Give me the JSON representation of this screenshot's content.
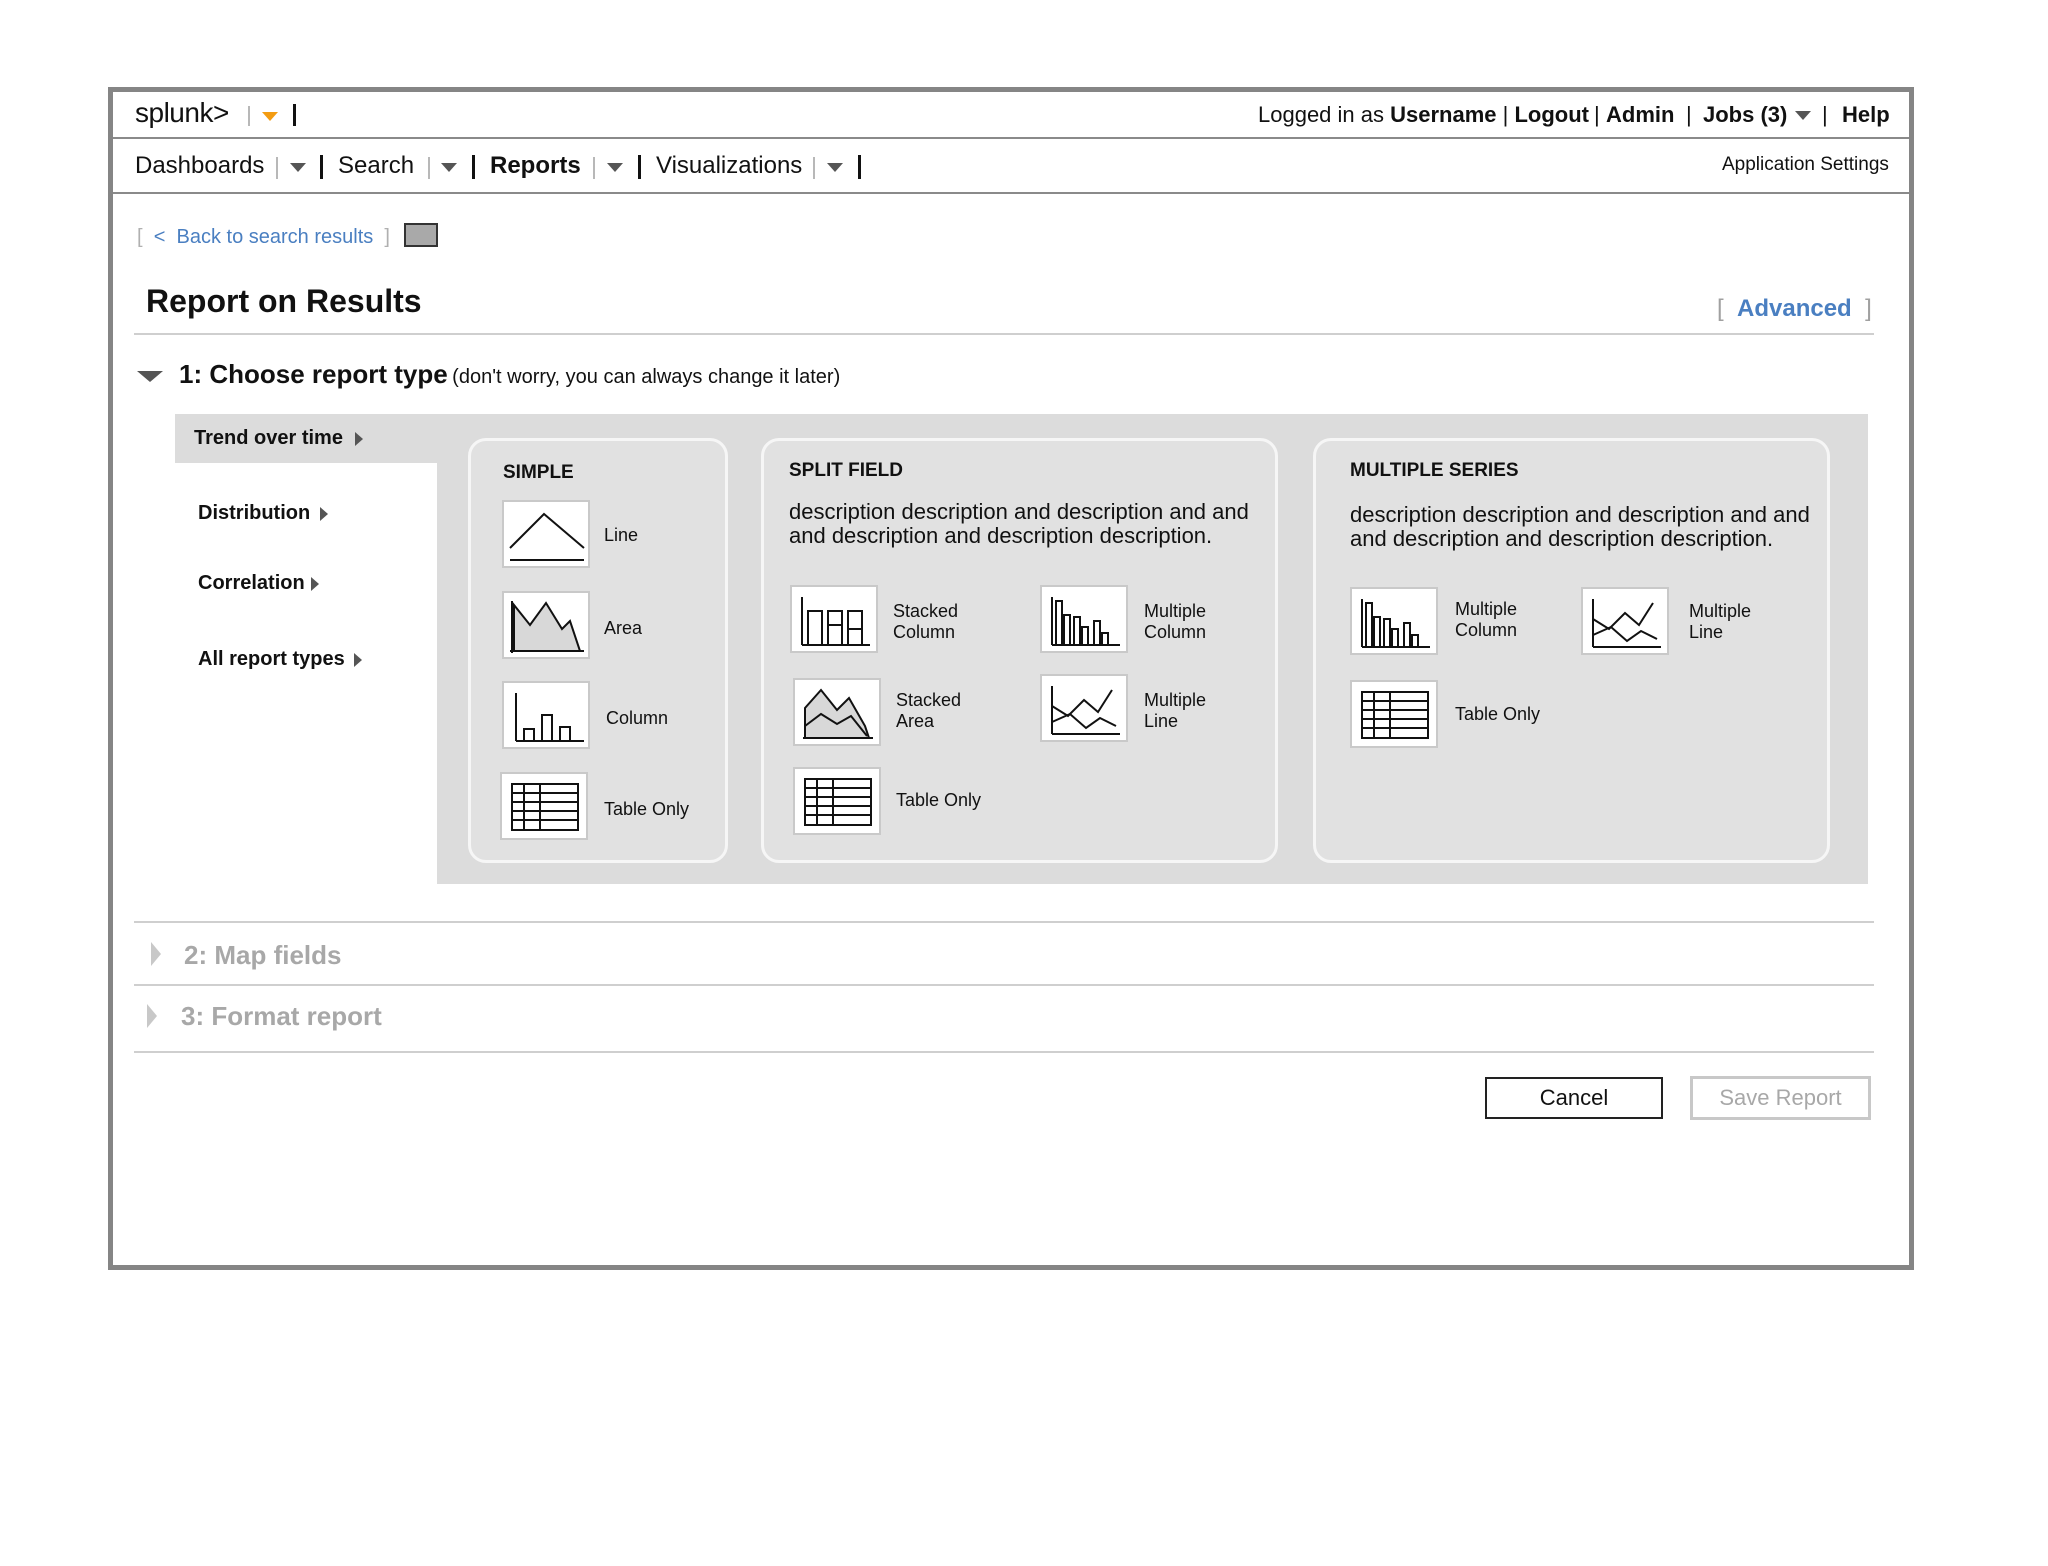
{
  "header": {
    "logo": "splunk>",
    "logged_in_prefix": "Logged in as",
    "username": "Username",
    "logout": "Logout",
    "admin": "Admin",
    "jobs": "Jobs (3)",
    "help": "Help"
  },
  "nav": {
    "items": [
      {
        "label": "Dashboards"
      },
      {
        "label": "Search"
      },
      {
        "label": "Reports"
      },
      {
        "label": "Visualizations"
      }
    ],
    "app_settings": "Application Settings"
  },
  "back_link": "Back to search results",
  "back_chevron": "<",
  "page_title": "Report on Results",
  "advanced": "Advanced",
  "step1": {
    "title": "1: Choose report type",
    "hint": "(don't worry, you can always change it later)"
  },
  "report_types": [
    {
      "label": "Trend over time",
      "selected": true
    },
    {
      "label": "Distribution"
    },
    {
      "label": "Correlation"
    },
    {
      "label": "All report types"
    }
  ],
  "simple": {
    "title": "SIMPLE",
    "options": [
      {
        "label": "Line",
        "icon": "line-chart-icon"
      },
      {
        "label": "Area",
        "icon": "area-chart-icon"
      },
      {
        "label": "Column",
        "icon": "column-chart-icon"
      },
      {
        "label": "Table Only",
        "icon": "table-icon"
      }
    ]
  },
  "split": {
    "title": "SPLIT FIELD",
    "description": "description description and description and and and description and description description.",
    "options": [
      {
        "label1": "Stacked",
        "label2": "Column",
        "icon": "stacked-column-icon"
      },
      {
        "label1": "Multiple",
        "label2": "Column",
        "icon": "multiple-column-icon"
      },
      {
        "label1": "Stacked",
        "label2": "Area",
        "icon": "stacked-area-icon"
      },
      {
        "label1": "Multiple",
        "label2": "Line",
        "icon": "multiple-line-icon"
      },
      {
        "label1": "Table Only",
        "label2": "",
        "icon": "table-icon"
      }
    ]
  },
  "multiple": {
    "title": "MULTIPLE SERIES",
    "description": "description description and description and and and description and description description.",
    "options": [
      {
        "label1": "Multiple",
        "label2": "Column",
        "icon": "multiple-column-icon"
      },
      {
        "label1": "Multiple",
        "label2": "Line",
        "icon": "multiple-line-icon"
      },
      {
        "label1": "Table Only",
        "label2": "",
        "icon": "table-icon"
      }
    ]
  },
  "step2": {
    "title": "2: Map fields"
  },
  "step3": {
    "title": "3: Format report"
  },
  "buttons": {
    "cancel": "Cancel",
    "save": "Save Report"
  },
  "colors": {
    "link": "#4a7fc1",
    "accent": "#f39c12",
    "panel": "#dcdcdc",
    "frame": "#858585",
    "disabled": "#a8a8a8"
  }
}
